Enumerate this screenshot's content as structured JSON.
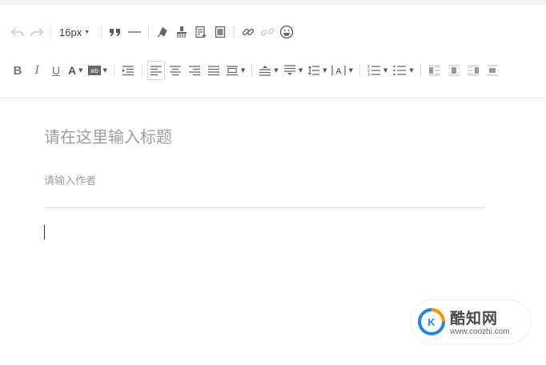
{
  "toolbar": {
    "font_size": "16px",
    "row1": [
      {
        "name": "undo-icon",
        "disabled": true
      },
      {
        "name": "redo-icon",
        "disabled": true
      },
      {
        "name": "blockquote-icon"
      },
      {
        "name": "horizontal-rule-icon"
      },
      {
        "name": "clear-format-icon"
      },
      {
        "name": "format-painter-icon"
      },
      {
        "name": "insert-template-icon"
      },
      {
        "name": "paste-plain-icon"
      },
      {
        "name": "link-icon"
      },
      {
        "name": "unlink-icon",
        "disabled": true
      },
      {
        "name": "emoji-icon"
      }
    ],
    "row2": [
      {
        "name": "bold-icon"
      },
      {
        "name": "italic-icon"
      },
      {
        "name": "underline-icon"
      },
      {
        "name": "font-color-icon"
      },
      {
        "name": "highlight-color-icon"
      },
      {
        "name": "indent-icon"
      },
      {
        "name": "align-left-icon"
      },
      {
        "name": "align-center-icon"
      },
      {
        "name": "align-right-icon"
      },
      {
        "name": "align-justify-icon"
      },
      {
        "name": "image-float-icon"
      },
      {
        "name": "paragraph-spacing-top-icon"
      },
      {
        "name": "paragraph-spacing-bottom-icon"
      },
      {
        "name": "line-height-icon"
      },
      {
        "name": "letter-spacing-icon"
      },
      {
        "name": "ordered-list-icon"
      },
      {
        "name": "unordered-list-icon"
      },
      {
        "name": "image-left-icon"
      },
      {
        "name": "image-center-icon"
      },
      {
        "name": "image-right-icon"
      },
      {
        "name": "image-none-icon"
      }
    ]
  },
  "editor": {
    "title_placeholder": "请在这里输入标题",
    "title_value": "",
    "author_placeholder": "请输入作者",
    "author_value": ""
  },
  "watermark": {
    "name": "酷知网",
    "url": "www.coozhi.com"
  },
  "colors": {
    "toolbar_bg": "#ffffff",
    "icon": "#666666",
    "placeholder": "#9d9d9d",
    "brand_blue": "#1f87e0",
    "brand_orange": "#f39800"
  }
}
